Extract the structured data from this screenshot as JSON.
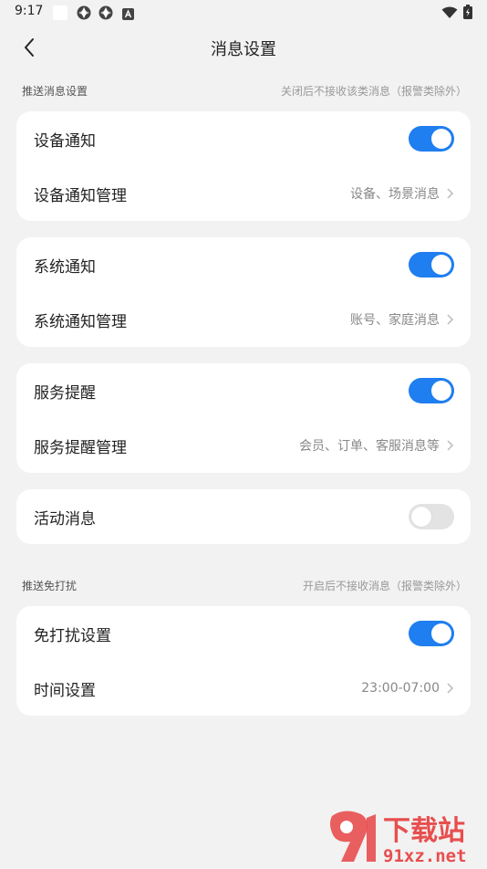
{
  "status_bar": {
    "time": "9:17",
    "icons": [
      "notification-square-icon",
      "app-icon",
      "app-icon",
      "accessibility-icon"
    ],
    "right_icons": [
      "wifi-icon",
      "battery-icon"
    ]
  },
  "nav": {
    "title": "消息设置",
    "back_icon": "chevron-left-icon"
  },
  "sections": {
    "push": {
      "title": "推送消息设置",
      "note": "关闭后不接收该类消息（报警类除外）"
    },
    "dnd": {
      "title": "推送免打扰",
      "note": "开启后不接收消息（报警类除外）"
    }
  },
  "cards": {
    "device": {
      "toggle_label": "设备通知",
      "toggle_on": true,
      "manage_label": "设备通知管理",
      "manage_value": "设备、场景消息"
    },
    "system": {
      "toggle_label": "系统通知",
      "toggle_on": true,
      "manage_label": "系统通知管理",
      "manage_value": "账号、家庭消息"
    },
    "service": {
      "toggle_label": "服务提醒",
      "toggle_on": true,
      "manage_label": "服务提醒管理",
      "manage_value": "会员、订单、客服消息等"
    },
    "activity": {
      "toggle_label": "活动消息",
      "toggle_on": false
    },
    "dnd": {
      "toggle_label": "免打扰设置",
      "toggle_on": true,
      "manage_label": "时间设置",
      "manage_value": "23:00-07:00"
    }
  },
  "colors": {
    "accent": "#1f7ef0",
    "background": "#f2f2f2",
    "card": "#ffffff",
    "toggle_off": "#e3e3e3"
  },
  "watermark": {
    "text": "下载站",
    "domain": "91xz.net"
  }
}
